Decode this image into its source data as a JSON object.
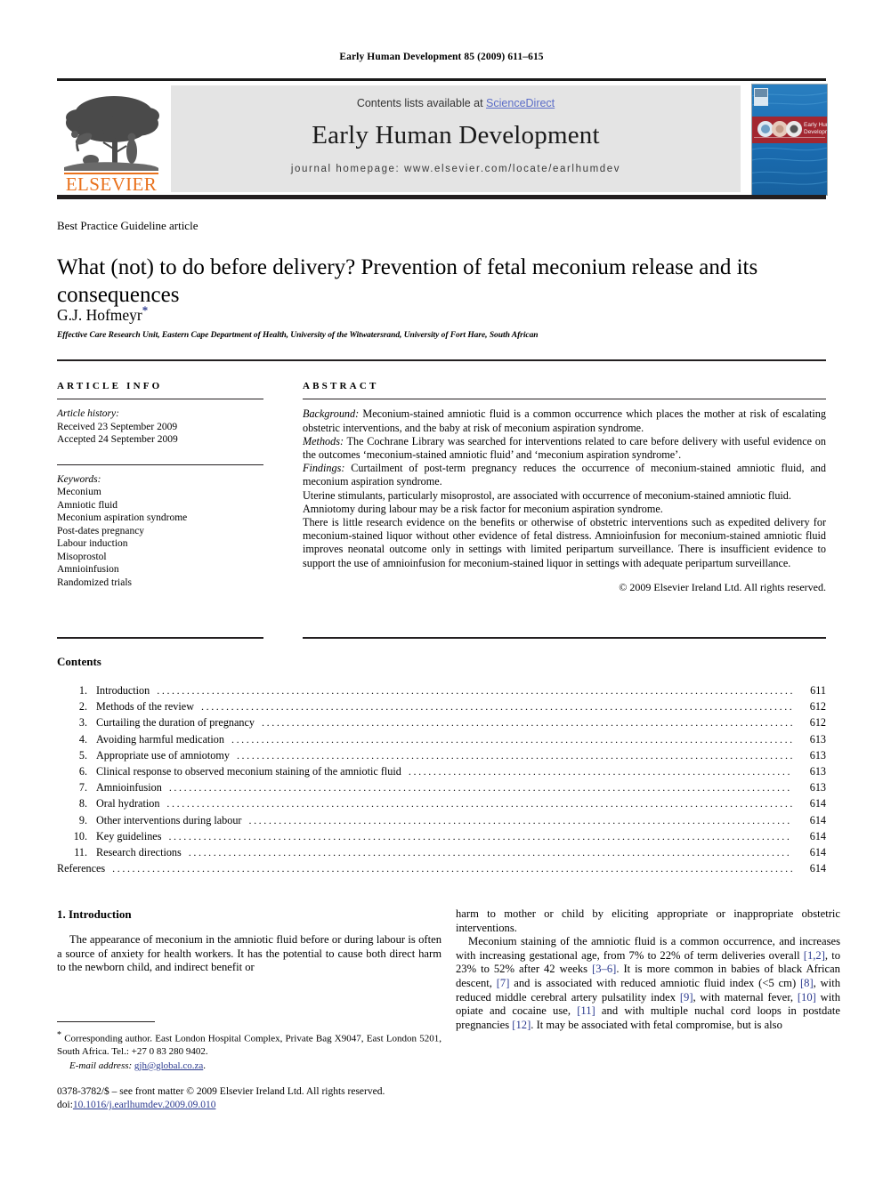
{
  "running_head": "Early Human Development 85 (2009) 611–615",
  "masthead": {
    "contents_prefix": "Contents lists available at ",
    "sciencedirect_link": "ScienceDirect",
    "journal_title": "Early Human Development",
    "homepage_label": "journal homepage: www.elsevier.com/locate/earlhumdev",
    "publisher_logo_text": "ELSEVIER",
    "cover_badge_title": "Early Human Development",
    "link_color": "#5b6dc8",
    "band_bg": "#e4e4e4"
  },
  "article": {
    "doctype": "Best Practice Guideline article",
    "title": "What (not) to do before delivery? Prevention of fetal meconium release and its consequences",
    "authors": "G.J. Hofmeyr",
    "author_marker": "*",
    "affiliation": "Effective Care Research Unit, Eastern Cape Department of Health, University of the Witwatersrand, University of Fort Hare, South African"
  },
  "info": {
    "heading": "ARTICLE INFO",
    "history_label": "Article history:",
    "history": [
      "Received 23 September 2009",
      "Accepted 24 September 2009"
    ],
    "keywords_label": "Keywords:",
    "keywords": [
      "Meconium",
      "Amniotic fluid",
      "Meconium aspiration syndrome",
      "Post-dates pregnancy",
      "Labour induction",
      "Misoprostol",
      "Amnioinfusion",
      "Randomized trials"
    ]
  },
  "abstract": {
    "heading": "ABSTRACT",
    "background_label": "Background:",
    "background_text": " Meconium-stained amniotic fluid is a common occurrence which places the mother at risk of escalating obstetric interventions, and the baby at risk of meconium aspiration syndrome.",
    "methods_label": "Methods:",
    "methods_text": " The Cochrane Library was searched for interventions related to care before delivery with useful evidence on the outcomes ‘meconium-stained amniotic fluid’ and ‘meconium aspiration syndrome’.",
    "findings_label": "Findings:",
    "findings_text": " Curtailment of post-term pregnancy reduces the occurrence of meconium-stained amniotic fluid, and meconium aspiration syndrome.",
    "para4": "Uterine stimulants, particularly misoprostol, are associated with occurrence of meconium-stained amniotic fluid.",
    "para5": "Amniotomy during labour may be a risk factor for meconium aspiration syndrome.",
    "para6": "There is little research evidence on the benefits or otherwise of obstetric interventions such as expedited delivery for meconium-stained liquor without other evidence of fetal distress. Amnioinfusion for meconium-stained amniotic fluid improves neonatal outcome only in settings with limited peripartum surveillance. There is insufficient evidence to support the use of amnioinfusion for meconium-stained liquor in settings with adequate peripartum surveillance.",
    "copyright": "© 2009 Elsevier Ireland Ltd. All rights reserved."
  },
  "contents": {
    "heading": "Contents",
    "rows": [
      {
        "num": "1.",
        "label": "Introduction",
        "page": "611"
      },
      {
        "num": "2.",
        "label": "Methods of the review",
        "page": "612"
      },
      {
        "num": "3.",
        "label": "Curtailing the duration of pregnancy",
        "page": "612"
      },
      {
        "num": "4.",
        "label": "Avoiding harmful medication",
        "page": "613"
      },
      {
        "num": "5.",
        "label": "Appropriate use of amniotomy",
        "page": "613"
      },
      {
        "num": "6.",
        "label": "Clinical response to observed meconium staining of the amniotic fluid",
        "page": "613"
      },
      {
        "num": "7.",
        "label": "Amnioinfusion",
        "page": "613"
      },
      {
        "num": "8.",
        "label": "Oral hydration",
        "page": "614"
      },
      {
        "num": "9.",
        "label": "Other interventions during labour",
        "page": "614"
      },
      {
        "num": "10.",
        "label": "Key guidelines",
        "page": "614"
      },
      {
        "num": "11.",
        "label": "Research directions",
        "page": "614"
      },
      {
        "num": "",
        "label": "References",
        "page": "614"
      }
    ]
  },
  "body": {
    "section_title": "1. Introduction",
    "left_para": "The appearance of meconium in the amniotic fluid before or during labour is often a source of anxiety for health workers. It has the potential to cause both direct harm to the newborn child, and indirect benefit or",
    "right_para_cont": "harm to mother or child by eliciting appropriate or inappropriate obstetric interventions.",
    "right_para2_a": "Meconium staining of the amniotic fluid is a common occurrence, and increases with increasing gestational age, from 7% to 22% of term deliveries overall ",
    "ref_1_2": "[1,2]",
    "right_para2_b": ", to 23% to 52% after 42 weeks ",
    "ref_3_6": "[3–6]",
    "right_para2_c": ". It is more common in babies of black African descent, ",
    "ref_7": "[7]",
    "right_para2_d": " and is associated with reduced amniotic fluid index (<5 cm) ",
    "ref_8": "[8]",
    "right_para2_e": ", with reduced middle cerebral artery pulsatility index ",
    "ref_9": "[9]",
    "right_para2_f": ", with maternal fever, ",
    "ref_10": "[10]",
    "right_para2_g": " with opiate and cocaine use, ",
    "ref_11": "[11]",
    "right_para2_h": " and with multiple nuchal cord loops in postdate pregnancies ",
    "ref_12": "[12]",
    "right_para2_i": ". It may be associated with fetal compromise, but is also"
  },
  "footnote": {
    "marker": "*",
    "corresponding": " Corresponding author. East London Hospital Complex, Private Bag X9047, East London 5201, South Africa. Tel.: +27 0 83 280 9402.",
    "email_label": "E-mail address:",
    "email": "gjh@global.co.za",
    "email_suffix": "."
  },
  "imprint": {
    "issn_line": "0378-3782/$ – see front matter © 2009 Elsevier Ireland Ltd. All rights reserved.",
    "doi_label": "doi:",
    "doi_value": "10.1016/j.earlhumdev.2009.09.010"
  }
}
